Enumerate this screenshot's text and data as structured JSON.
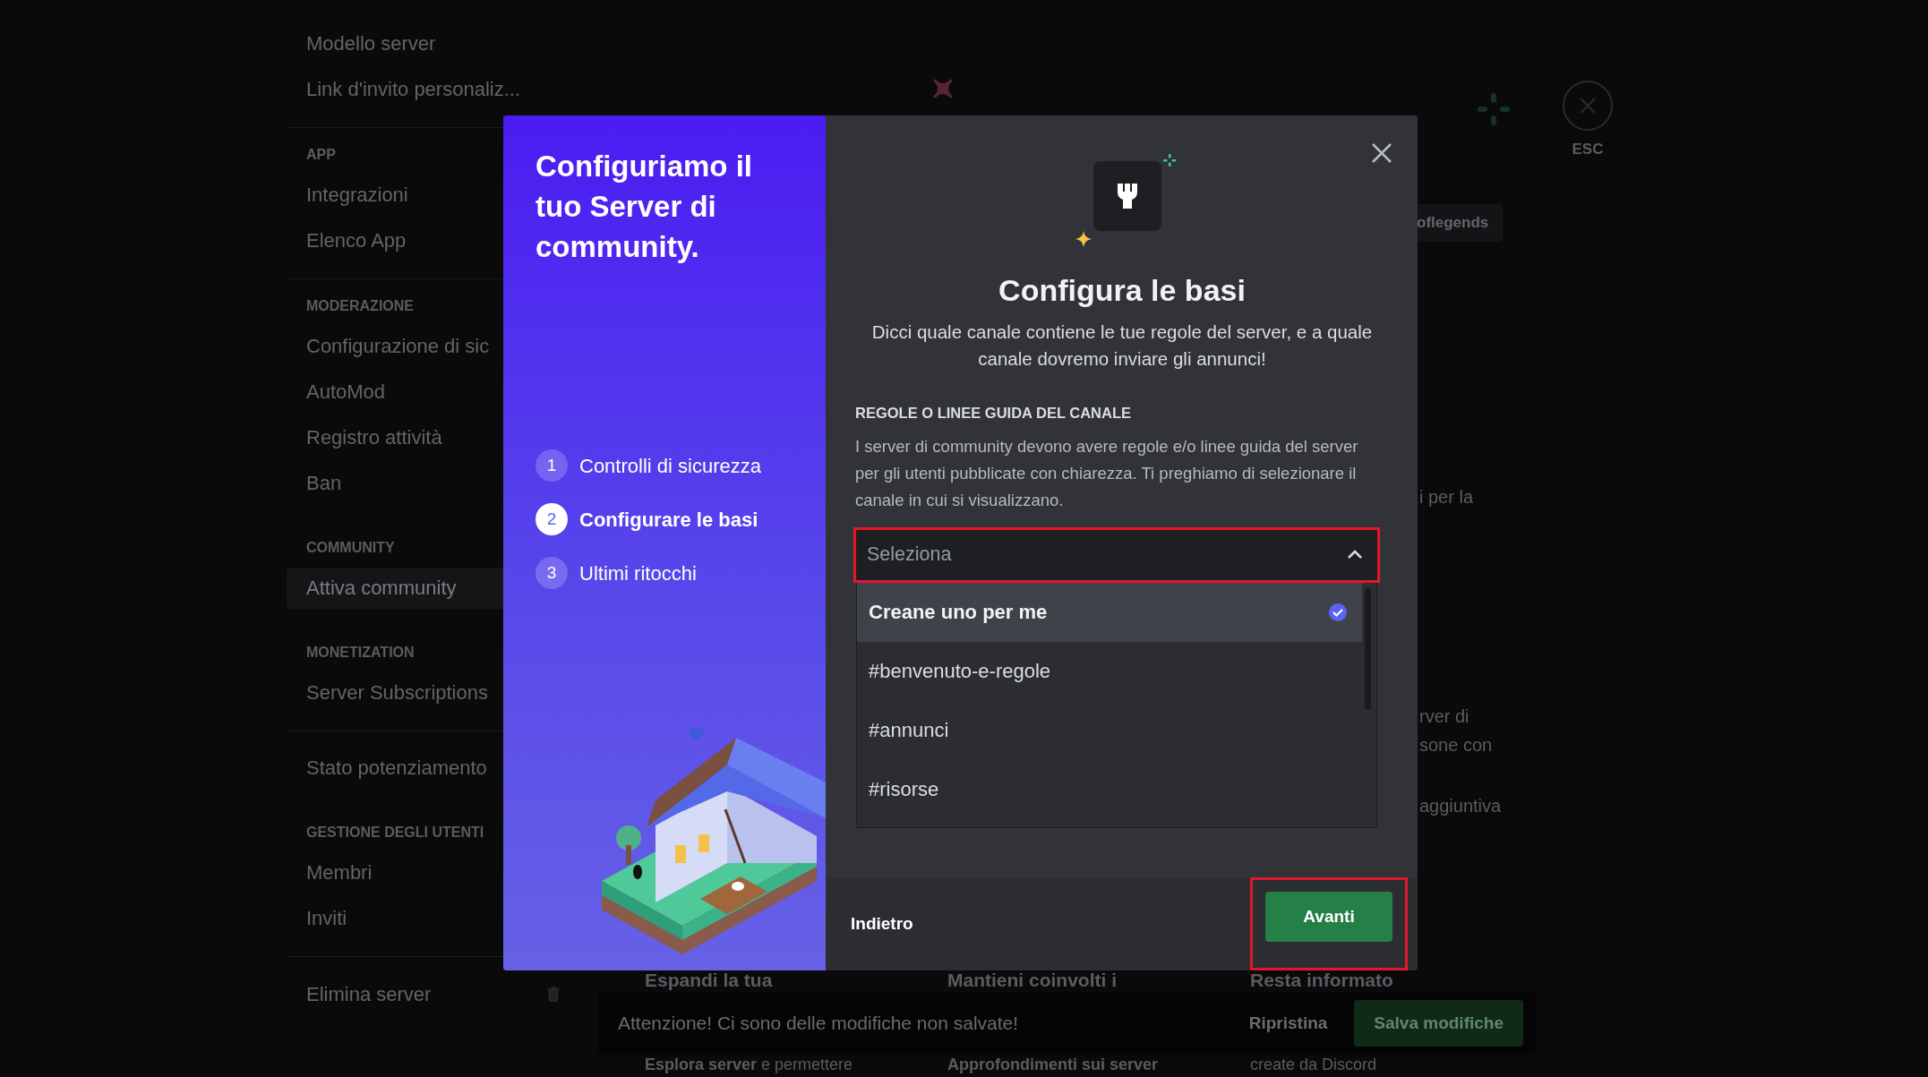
{
  "sidebar": {
    "groups": [
      {
        "divider": true,
        "items": [
          {
            "label": "Modello server",
            "selected": false
          },
          {
            "label": "Link d'invito personaliz...",
            "selected": false
          }
        ]
      },
      {
        "header": "APP",
        "divider": true,
        "items": [
          {
            "label": "Integrazioni",
            "selected": false
          },
          {
            "label": "Elenco App",
            "selected": false
          }
        ]
      },
      {
        "header": "MODERAZIONE",
        "divider": false,
        "items": [
          {
            "label": "Configurazione di sic",
            "selected": false
          },
          {
            "label": "AutoMod",
            "selected": false
          },
          {
            "label": "Registro attività",
            "selected": false
          },
          {
            "label": "Ban",
            "selected": false
          }
        ]
      },
      {
        "header": "COMMUNITY",
        "divider": false,
        "items": [
          {
            "label": "Attiva community",
            "selected": true
          }
        ]
      },
      {
        "header": "MONETIZATION",
        "divider": true,
        "items": [
          {
            "label": "Server Subscriptions",
            "selected": false
          }
        ]
      },
      {
        "divider": false,
        "items": [
          {
            "label": "Stato potenziamento",
            "selected": false
          }
        ]
      },
      {
        "header": "GESTIONE DEGLI UTENTI",
        "divider": true,
        "items": [
          {
            "label": "Membri",
            "selected": false
          },
          {
            "label": "Inviti",
            "selected": false
          }
        ]
      }
    ],
    "delete_item": {
      "label": "Elimina server"
    }
  },
  "close_button": {
    "label": "ESC"
  },
  "background": {
    "chip": "oflegends",
    "fragments": [
      "i per la",
      "rver di",
      "sone con",
      "aggiuntiva"
    ],
    "headings": [
      "Espandi la tua",
      "Mantieni coinvolti i",
      "Resta informato"
    ],
    "captions": [
      "**Esplora server** e permettere",
      "**Approfondimenti sui server**",
      "create da Discord"
    ]
  },
  "unsaved_bar": {
    "message": "Attenzione! Ci sono delle modifiche non salvate!",
    "reset": "Ripristina",
    "save": "Salva modifiche"
  },
  "modal": {
    "sidebar_title": "Configuriamo il tuo Server di community.",
    "steps": [
      {
        "number": "1",
        "label": "Controlli di sicurezza",
        "selected": false
      },
      {
        "number": "2",
        "label": "Configurare le basi",
        "selected": true
      },
      {
        "number": "3",
        "label": "Ultimi ritocchi",
        "selected": false
      }
    ],
    "title": "Configura le basi",
    "description": "Dicci quale canale contiene le tue regole del server, e a quale canale dovremo inviare gli annunci!",
    "section_label": "REGOLE O LINEE GUIDA DEL CANALE",
    "section_text": "I server di community devono avere regole e/o linee guida del server per gli utenti pubblicate con chiarezza. Ti preghiamo di selezionare il canale in cui si visualizzano.",
    "select": {
      "placeholder": "Seleziona",
      "expanded": true,
      "highlighted": true
    },
    "options": [
      {
        "label": "Creane uno per me",
        "selected": true
      },
      {
        "label": "#benvenuto-e-regole",
        "selected": false
      },
      {
        "label": "#annunci",
        "selected": false
      },
      {
        "label": "#risorse",
        "selected": false
      }
    ],
    "back": "Indietro",
    "next": {
      "label": "Avanti",
      "highlighted": true
    }
  }
}
